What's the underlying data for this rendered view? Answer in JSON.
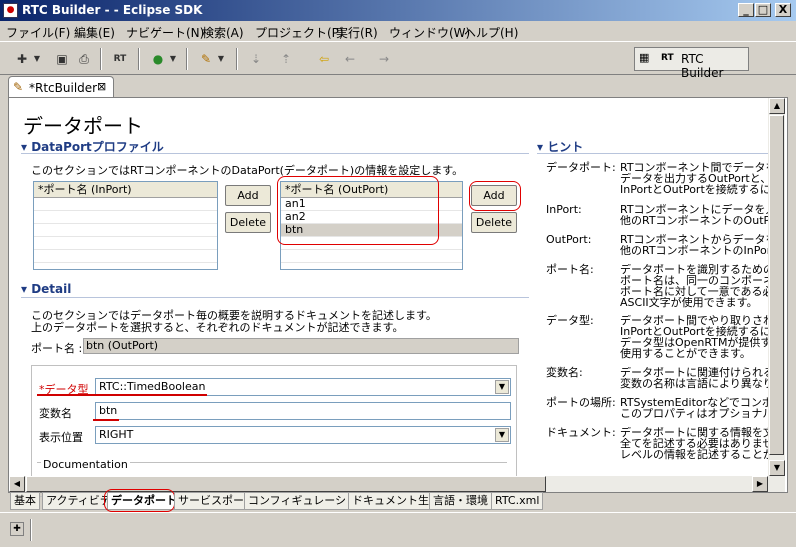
{
  "window": {
    "title": "RTC Builder - - Eclipse SDK",
    "icon_text": "●",
    "buttons": [
      "_",
      "□",
      "X"
    ]
  },
  "menu": [
    "ファイル(F)",
    "編集(E)",
    "ナビゲート(N)",
    "検索(A)",
    "プロジェクト(P)",
    "実行(R)",
    "ウィンドウ(W)",
    "ヘルプ(H)"
  ],
  "toolbar": {
    "icons": [
      "new-icon",
      "save-icon",
      "print-icon",
      "rt-icon",
      "run-icon",
      "tool-icon",
      "next-annotation-icon",
      "prev-annotation-icon",
      "last-edit-icon",
      "back-icon",
      "forward-icon"
    ],
    "rt_label": "RT"
  },
  "perspective": {
    "label": "RTC Builder",
    "rt_label": "RT"
  },
  "editor_tab": {
    "label": "*RtcBuilder",
    "close": "⊠"
  },
  "page_title": "データポート",
  "dataport_section": {
    "heading": "DataPortプロファイル",
    "description": "このセクションではRTコンポーネントのDataPort(データポート)の情報を設定します。",
    "inport_header": "*ポート名 (InPort)",
    "inport_rows": [],
    "outport_header": "*ポート名 (OutPort)",
    "outport_rows": [
      "an1",
      "an2",
      "btn"
    ],
    "add_label": "Add",
    "delete_label": "Delete"
  },
  "detail_section": {
    "heading": "Detail",
    "desc1": "このセクションではデータポート毎の概要を説明するドキュメントを記述します。",
    "desc2": "上のデータポートを選択すると、それぞれのドキュメントが記述できます。",
    "port_name_label": "ポート名 :",
    "port_name_value": "btn (OutPort)",
    "datatype_label": "*データ型",
    "datatype_value": "RTC::TimedBoolean",
    "varname_label": "変数名",
    "varname_value": "btn",
    "position_label": "表示位置",
    "position_value": "RIGHT",
    "documentation_label": "Documentation"
  },
  "hint_section": {
    "heading": "ヒント",
    "rows": [
      {
        "key": "データポート:",
        "lines": [
          "RTコンポーネント間でデータをや",
          "データを出力するOutPortと、デー",
          "InPortとOutPortを接続するには、"
        ]
      },
      {
        "key": "InPort:",
        "lines": [
          "RTコンポーネントにデータを入力",
          "他のRTコンポーネントのOutPort"
        ]
      },
      {
        "key": "OutPort:",
        "lines": [
          "RTコンポーネントからデータを出力",
          "他のRTコンポーネントのInPortと"
        ]
      },
      {
        "key": "ポート名:",
        "lines": [
          "データポートを識別するための名",
          "ポート名は、同一のコンポーネン",
          "ポート名に対して一意である必要",
          "ASCII文字が使用できます。"
        ]
      },
      {
        "key": "データ型:",
        "lines": [
          "データポート間でやり取りされる",
          "InPortとOutPortを接続するには、",
          "データ型はOpenRTMが提供す",
          "使用することができます。"
        ]
      },
      {
        "key": "変数名:",
        "lines": [
          "データポートに関連付けられる変",
          "変数の名称は言語により異なりま"
        ]
      },
      {
        "key": "ポートの場所:",
        "lines": [
          "RTSystemEditorなどでコンポー",
          "このプロパティはオプショナルです"
        ]
      },
      {
        "key": "ドキュメント:",
        "lines": [
          "データポートに関する情報を文書",
          "全てを記述する必要はありません",
          "レベルの情報を記述することが推"
        ]
      }
    ]
  },
  "bottom_tabs": [
    "基本",
    "アクティビティ",
    "データポート",
    "サービスポート",
    "コンフィギュレーション",
    "ドキュメント生成",
    "言語・環境",
    "RTC.xml"
  ],
  "active_tab": "データポート"
}
